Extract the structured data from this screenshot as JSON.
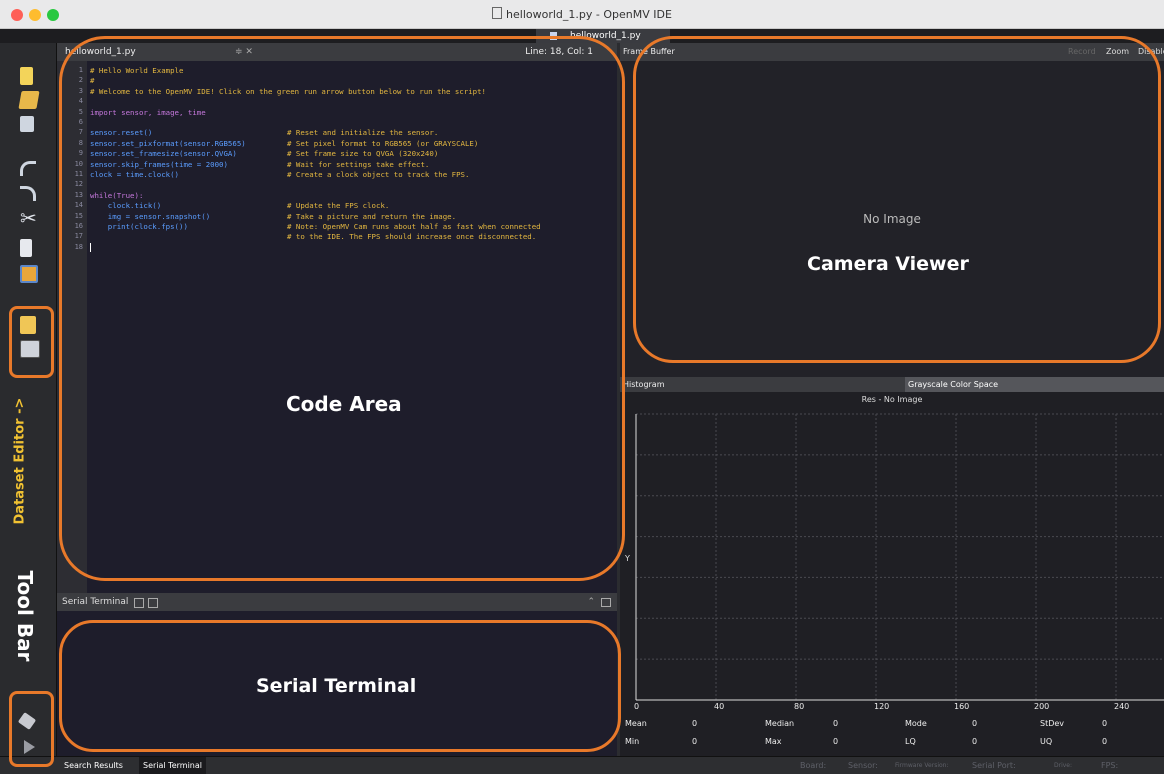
{
  "window": {
    "title": "helloworld_1.py - OpenMV IDE",
    "file_tab": "helloworld_1.py"
  },
  "editor": {
    "tab_label": "helloworld_1.py",
    "tab_controls": "≑ ✕",
    "cursor_position": "Line: 18, Col: 1",
    "line_numbers": [
      "1",
      "2",
      "3",
      "4",
      "5",
      "6",
      "7",
      "8",
      "9",
      "10",
      "11",
      "12",
      "13",
      "14",
      "15",
      "16",
      "17",
      "18"
    ],
    "lines": [
      {
        "code": "# Hello World Example",
        "comment": ""
      },
      {
        "code": "#",
        "comment": ""
      },
      {
        "code": "# Welcome to the OpenMV IDE! Click on the green run arrow button below to run the script!",
        "comment": ""
      },
      {
        "code": "",
        "comment": ""
      },
      {
        "code": "import sensor, image, time",
        "comment": ""
      },
      {
        "code": "",
        "comment": ""
      },
      {
        "code": "sensor.reset()",
        "comment": "# Reset and initialize the sensor."
      },
      {
        "code": "sensor.set_pixformat(sensor.RGB565)",
        "comment": "# Set pixel format to RGB565 (or GRAYSCALE)"
      },
      {
        "code": "sensor.set_framesize(sensor.QVGA)",
        "comment": "# Set frame size to QVGA (320x240)"
      },
      {
        "code": "sensor.skip_frames(time = 2000)",
        "comment": "# Wait for settings take effect."
      },
      {
        "code": "clock = time.clock()",
        "comment": "# Create a clock object to track the FPS."
      },
      {
        "code": "",
        "comment": ""
      },
      {
        "code": "while(True):",
        "comment": ""
      },
      {
        "code": "    clock.tick()",
        "comment": "# Update the FPS clock."
      },
      {
        "code": "    img = sensor.snapshot()",
        "comment": "# Take a picture and return the image."
      },
      {
        "code": "    print(clock.fps())",
        "comment": "# Note: OpenMV Cam runs about half as fast when connected"
      },
      {
        "code": "",
        "comment": "# to the IDE. The FPS should increase once disconnected."
      },
      {
        "code": "",
        "comment": ""
      }
    ]
  },
  "serial_terminal": {
    "header_label": "Serial Terminal"
  },
  "frame_buffer": {
    "header_label": "Frame Buffer",
    "record_label": "Record",
    "zoom_label": "Zoom",
    "disable_label": "Disable",
    "placeholder": "No Image"
  },
  "histogram": {
    "tab_label": "Histogram",
    "color_space": "Grayscale Color Space",
    "res_label": "Res - No Image",
    "y_axis_label": "Y",
    "x_ticks": [
      "0",
      "40",
      "80",
      "120",
      "160",
      "200",
      "240"
    ],
    "stats_row1": [
      {
        "label": "Mean",
        "value": "0"
      },
      {
        "label": "Median",
        "value": "0"
      },
      {
        "label": "Mode",
        "value": "0"
      },
      {
        "label": "StDev",
        "value": "0"
      }
    ],
    "stats_row2": [
      {
        "label": "Min",
        "value": "0"
      },
      {
        "label": "Max",
        "value": "0"
      },
      {
        "label": "LQ",
        "value": "0"
      },
      {
        "label": "UQ",
        "value": "0"
      }
    ]
  },
  "status_bar": {
    "tabs": [
      "Search Results",
      "Serial Terminal"
    ],
    "fields": [
      "Board:",
      "Sensor:",
      "Firmware Version:",
      "Serial Port:",
      "Drive:",
      "FPS:"
    ]
  },
  "annotations": {
    "code_area": "Code Area",
    "camera_viewer": "Camera Viewer",
    "serial_terminal": "Serial Terminal",
    "tool_bar": "Tool Bar",
    "dataset_editor": "Dataset Editor ->"
  },
  "colors": {
    "annotation": "#e8792a",
    "code_text": "#5b9dff",
    "comment_text": "#e3b740",
    "keyword": "#c678dd"
  },
  "toolbar_icons": [
    "new-file-icon",
    "open-file-icon",
    "save-icon",
    "undo-icon",
    "redo-icon",
    "cut-icon",
    "copy-icon",
    "paste-icon",
    "dataset-new-icon",
    "dataset-capture-icon",
    "connect-icon",
    "run-icon"
  ]
}
